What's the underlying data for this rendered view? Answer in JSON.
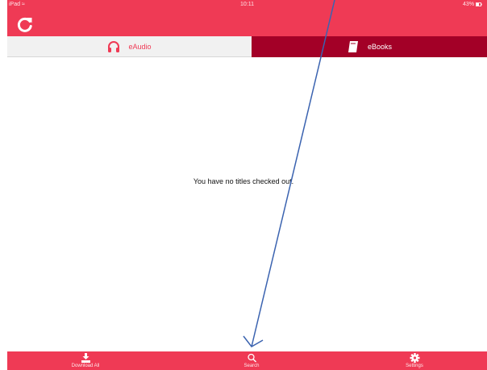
{
  "status_bar": {
    "carrier": "iPad ≈",
    "time": "10:11",
    "battery": "43%"
  },
  "toolbar": {
    "refresh_icon": "refresh-icon"
  },
  "tabs": [
    {
      "label": "eAudio",
      "icon": "headphones-icon",
      "selected": true
    },
    {
      "label": "eBooks",
      "icon": "book-icon",
      "selected": false
    }
  ],
  "main": {
    "empty_message": "You have no titles checked out."
  },
  "bottom_nav": [
    {
      "label": "Download All",
      "icon": "download-all-icon"
    },
    {
      "label": "Search",
      "icon": "search-icon"
    },
    {
      "label": "Settings",
      "icon": "gear-icon"
    }
  ],
  "colors": {
    "brand": "#ef3a55",
    "tab_selected_bg": "#a30027",
    "annotation_arrow": "#3b63b0"
  }
}
